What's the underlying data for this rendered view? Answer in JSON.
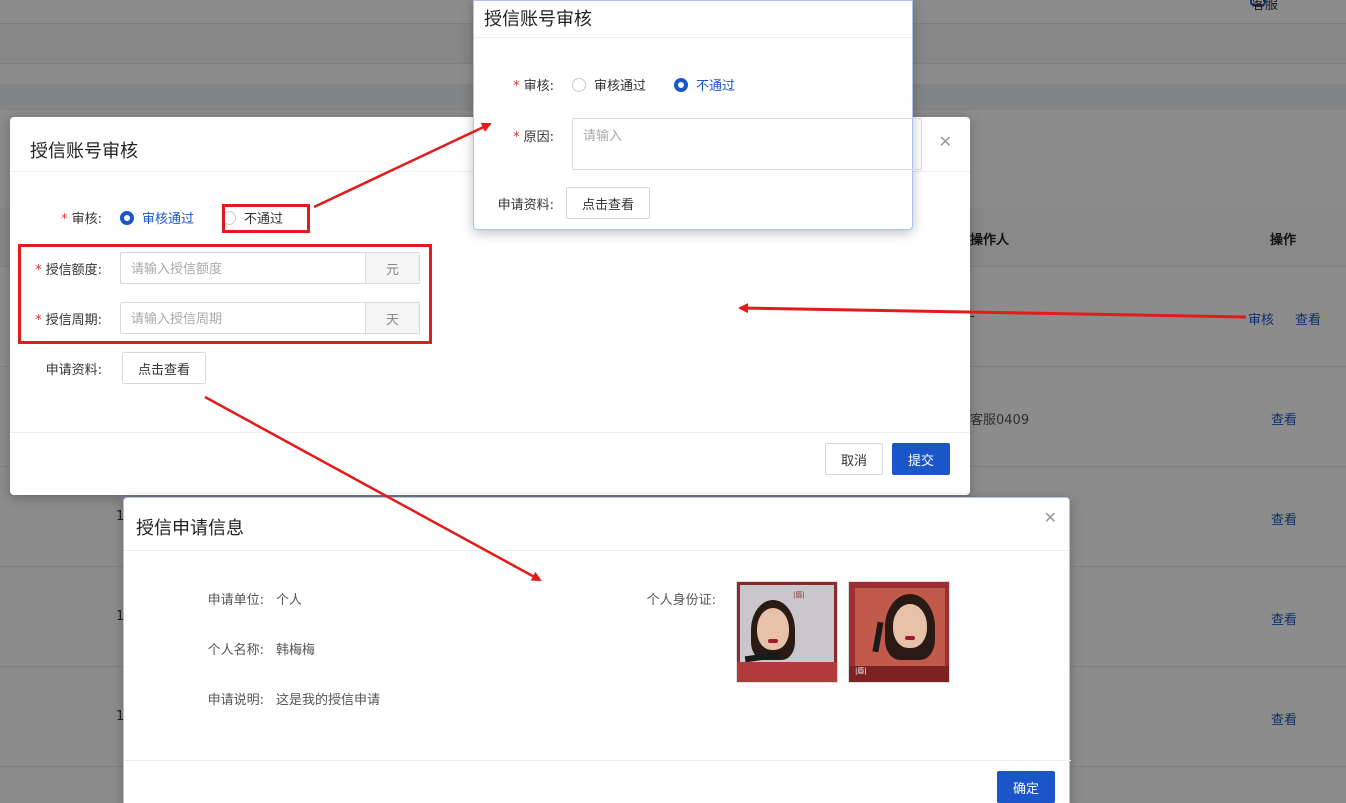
{
  "background": {
    "kefu_label": "客服",
    "table_headers": {
      "operator": "操作人",
      "action": "操作"
    },
    "rows": [
      {
        "num": "",
        "operator": "-",
        "actions": [
          "审核",
          "查看"
        ]
      },
      {
        "num": "",
        "operator": "客服0409",
        "actions": [
          "查看"
        ]
      },
      {
        "num": "1",
        "operator": "",
        "actions": [
          "查看"
        ]
      },
      {
        "num": "1",
        "operator": "",
        "actions": [
          "查看"
        ]
      },
      {
        "num": "1",
        "operator": "",
        "actions": [
          "查看"
        ]
      }
    ]
  },
  "main_modal": {
    "title": "授信账号审核",
    "review_label": "审核:",
    "radio_pass": "审核通过",
    "radio_reject": "不通过",
    "selected": "pass",
    "amount_label": "授信额度:",
    "amount_placeholder": "请输入授信额度",
    "amount_unit": "元",
    "period_label": "授信周期:",
    "period_placeholder": "请输入授信周期",
    "period_unit": "天",
    "materials_label": "申请资料:",
    "view_button": "点击查看",
    "cancel_button": "取消",
    "submit_button": "提交"
  },
  "reject_modal": {
    "title": "授信账号审核",
    "review_label": "审核:",
    "radio_pass": "审核通过",
    "radio_reject": "不通过",
    "selected": "reject",
    "reason_label": "原因:",
    "reason_placeholder": "请输入",
    "materials_label": "申请资料:",
    "view_button": "点击查看"
  },
  "info_modal": {
    "title": "授信申请信息",
    "fields": [
      {
        "key": "申请单位:",
        "value": "个人"
      },
      {
        "key": "个人名称:",
        "value": "韩梅梅"
      },
      {
        "key": "申请说明:",
        "value": "这是我的授信申请"
      }
    ],
    "id_label": "个人身份证:",
    "confirm_button": "确定"
  },
  "colors": {
    "primary": "#1a56c9",
    "annotation_red": "#e31b1b",
    "required": "#e03131"
  }
}
